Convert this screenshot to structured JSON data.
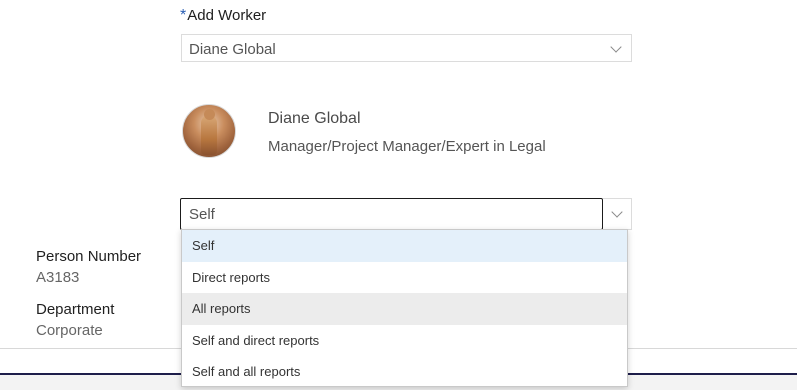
{
  "add_worker": {
    "required_mark": "*",
    "label": "Add Worker",
    "selected_value": "Diane Global"
  },
  "person": {
    "name": "Diane Global",
    "role": "Manager/Project Manager/Expert in Legal"
  },
  "scope": {
    "selected_value": "Self",
    "options": [
      "Self",
      "Direct reports",
      "All reports",
      "Self and direct reports",
      "Self and all reports"
    ]
  },
  "details": {
    "person_number_label": "Person Number",
    "person_number_value": "A3183",
    "department_label": "Department",
    "department_value": "Corporate"
  },
  "colors": {
    "required_mark": "#2b5fb4",
    "selected_option_bg": "#e4f0fa",
    "hover_option_bg": "#ececec",
    "footer_border": "#1d1d4a"
  }
}
